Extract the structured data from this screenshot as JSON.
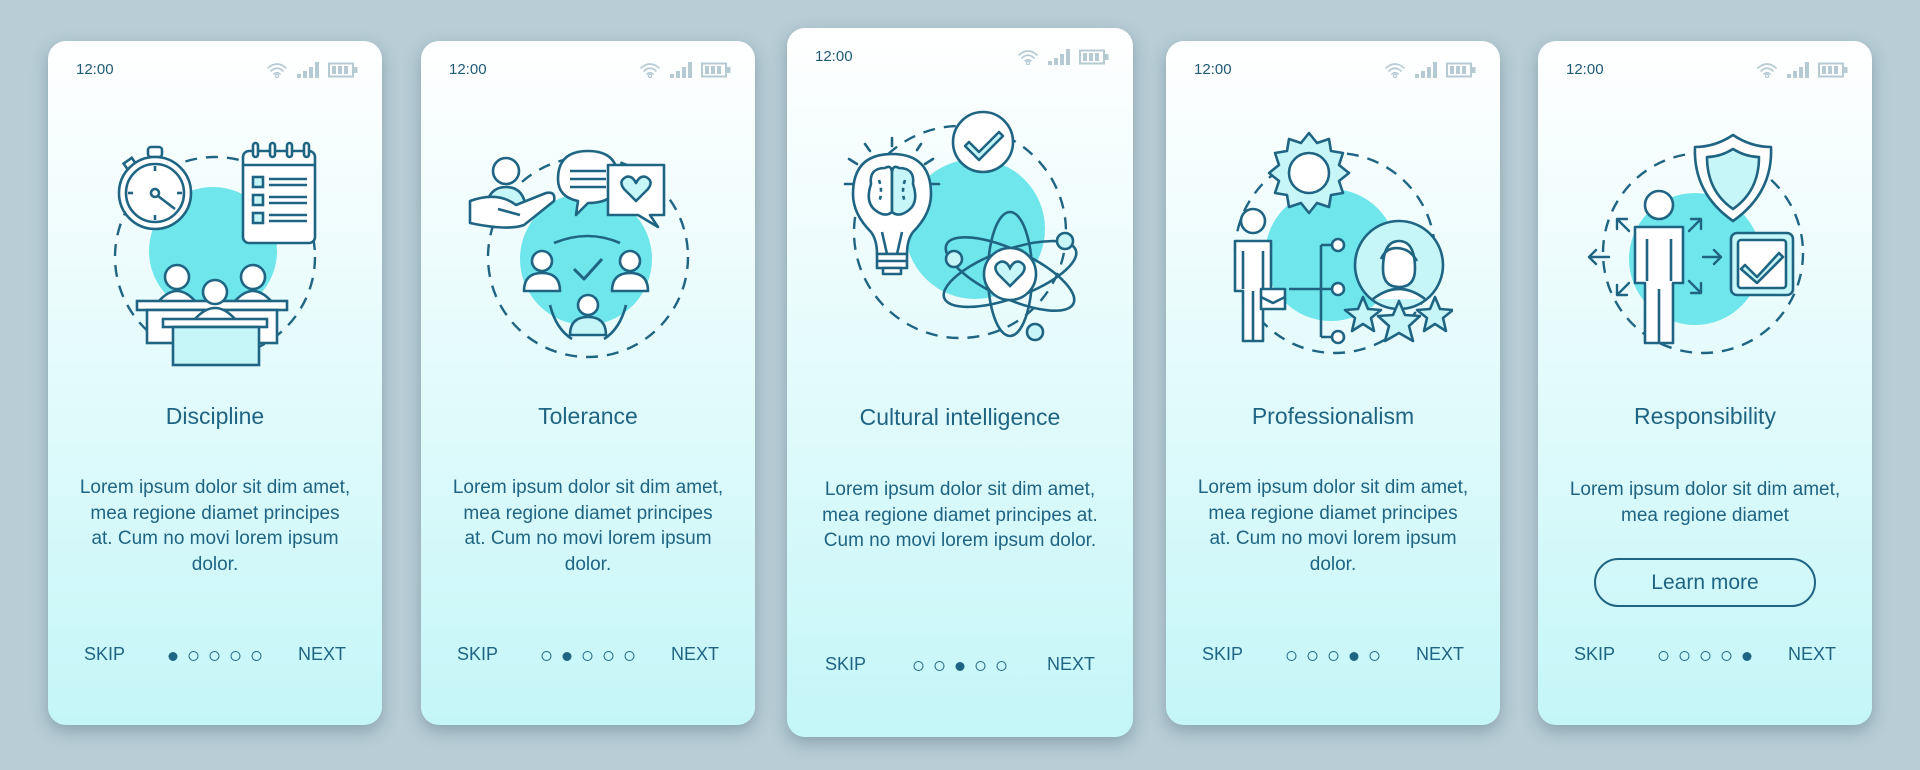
{
  "colors": {
    "background": "#b8cdd6",
    "accent": "#1f6583",
    "blob": "#6ee6ec",
    "status_icons": "#b6cad3"
  },
  "screens": [
    {
      "time": "12:00",
      "illustration": "discipline-illustration",
      "title": "Discipline",
      "description": "Lorem ipsum dolor sit dim amet, mea regione diamet principes at. Cum no movi lorem ipsum dolor.",
      "skip_label": "SKIP",
      "next_label": "NEXT",
      "page_index": 1,
      "page_count": 5
    },
    {
      "time": "12:00",
      "illustration": "tolerance-illustration",
      "title": "Tolerance",
      "description": "Lorem ipsum dolor sit dim amet, mea regione diamet principes at. Cum no movi lorem ipsum dolor.",
      "skip_label": "SKIP",
      "next_label": "NEXT",
      "page_index": 2,
      "page_count": 5
    },
    {
      "time": "12:00",
      "illustration": "cultural-intelligence-illustration",
      "title": "Cultural intelligence",
      "description": "Lorem ipsum dolor sit dim amet, mea regione diamet principes at. Cum no movi lorem ipsum dolor.",
      "skip_label": "SKIP",
      "next_label": "NEXT",
      "page_index": 3,
      "page_count": 5
    },
    {
      "time": "12:00",
      "illustration": "professionalism-illustration",
      "title": "Professionalism",
      "description": "Lorem ipsum dolor sit dim amet, mea regione diamet principes at. Cum no movi lorem ipsum dolor.",
      "skip_label": "SKIP",
      "next_label": "NEXT",
      "page_index": 4,
      "page_count": 5
    },
    {
      "time": "12:00",
      "illustration": "responsibility-illustration",
      "title": "Responsibility",
      "description": "Lorem ipsum dolor sit dim amet, mea regione diamet",
      "button_label": "Learn more",
      "skip_label": "SKIP",
      "next_label": "NEXT",
      "page_index": 5,
      "page_count": 5
    }
  ],
  "status_icons": [
    "wifi-icon",
    "signal-icon",
    "battery-icon"
  ]
}
